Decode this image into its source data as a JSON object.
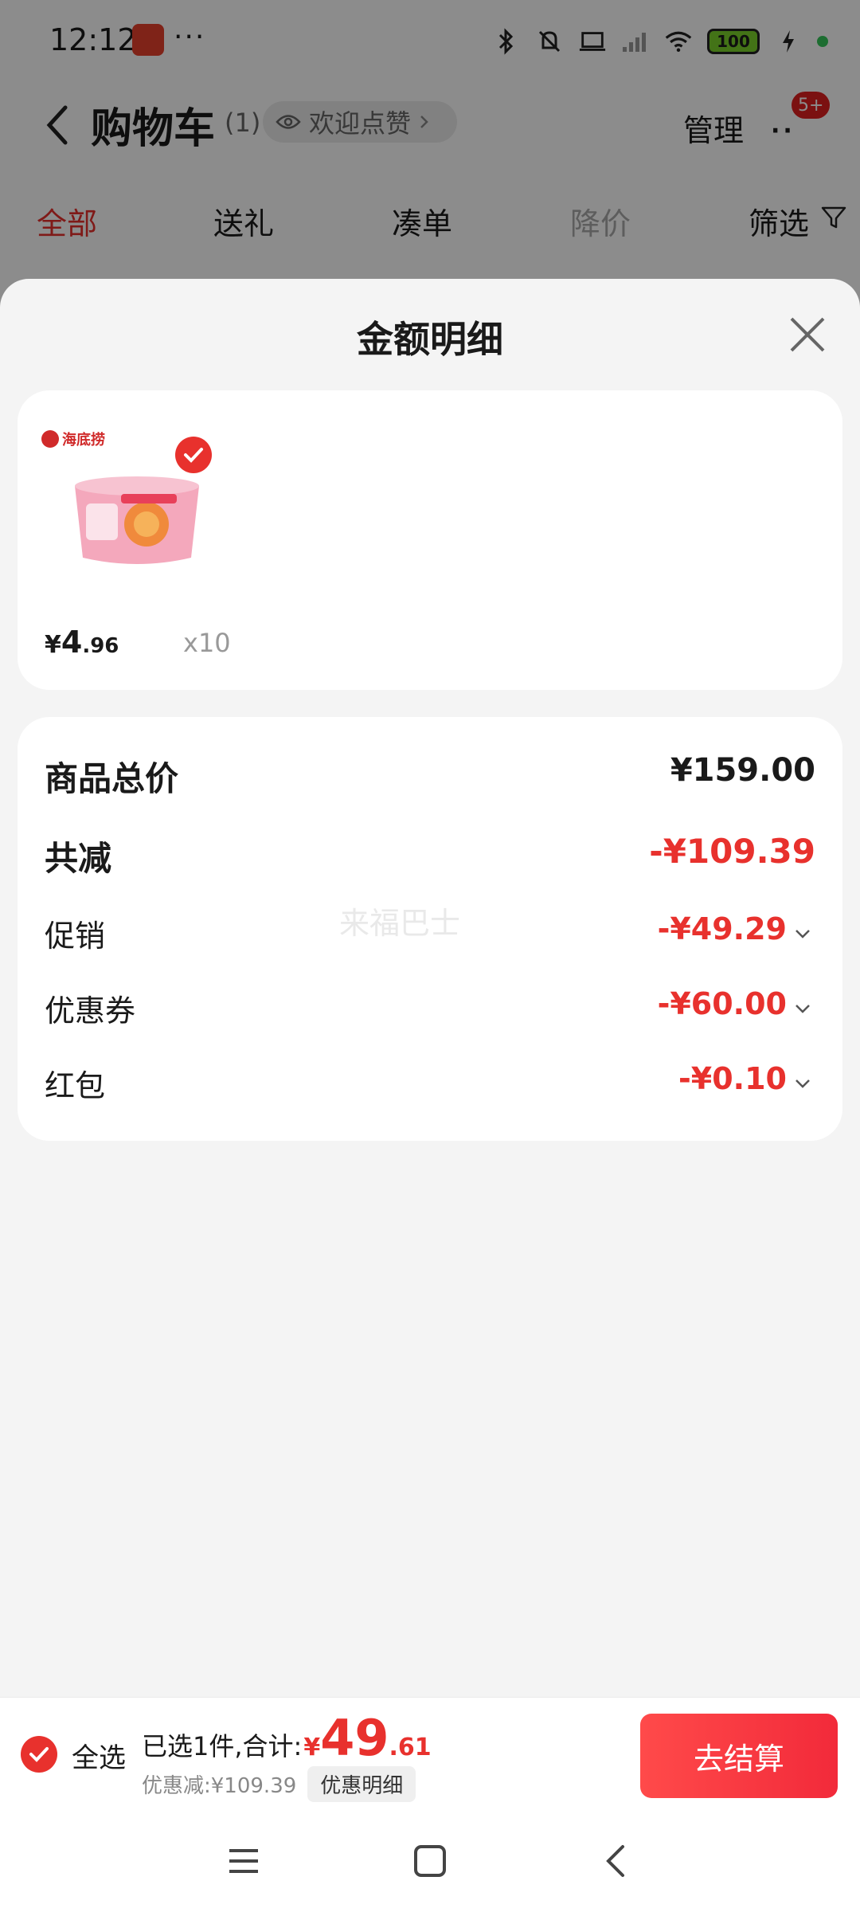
{
  "status_bar": {
    "time": "12:12",
    "more": "···",
    "battery": "100"
  },
  "nav": {
    "title": "购物车",
    "count": "(1)",
    "welcome": "欢迎点赞",
    "manage": "管理",
    "more": "··",
    "badge": "5+"
  },
  "tabs": [
    {
      "label": "全部",
      "state": "active"
    },
    {
      "label": "送礼",
      "state": "normal"
    },
    {
      "label": "凑单",
      "state": "normal"
    },
    {
      "label": "降价",
      "state": "muted"
    },
    {
      "label": "筛选",
      "state": "normal"
    }
  ],
  "sheet": {
    "title": "金额明细",
    "product": {
      "brand": "海底捞",
      "price_symbol": "¥",
      "price_int": "4",
      "price_dec": ".96",
      "quantity": "x10"
    },
    "details": [
      {
        "label": "商品总价",
        "value": "¥159.00",
        "style": "total"
      },
      {
        "label": "共减",
        "value": "-¥109.39",
        "style": "reduction"
      },
      {
        "label": "促销",
        "value": "-¥49.29",
        "style": "item"
      },
      {
        "label": "优惠券",
        "value": "-¥60.00",
        "style": "item"
      },
      {
        "label": "红包",
        "value": "-¥0.10",
        "style": "item"
      }
    ],
    "watermark": "来福巴士"
  },
  "checkout": {
    "select_all": "全选",
    "summary": "已选1件,合计:",
    "total_symbol": "¥",
    "total_int": "49",
    "total_dec": ".61",
    "discount": "优惠减:¥109.39",
    "discount_details": "优惠明细",
    "checkout_button": "去结算"
  },
  "colors": {
    "accent_red": "#e8312d",
    "sheet_bg": "#f4f4f4"
  }
}
